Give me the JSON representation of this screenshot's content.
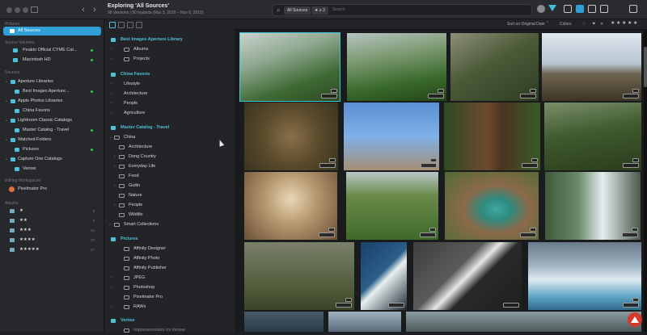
{
  "window": {
    "title": "Exploring 'All Sources'",
    "subtitle": "98 Versions | 90 Instants (Mar 3, 2010 – Nov 6, 2015)"
  },
  "search": {
    "chip_sources": "All Sources",
    "chip_rating": "★ ≥ 3",
    "placeholder": "Search"
  },
  "sidebar": {
    "sec_pictures": "Pictures",
    "all_sources": "All Sources",
    "sec_volumes": "Source Volumes",
    "vol1": "Peakto Official CYME Cat...",
    "vol2": "Macintosh HD",
    "sec_sources": "Sources",
    "aperture": "Aperture Libraries",
    "aperture_child": "Best Images Aperture...",
    "photos": "Apple Photos Libraries",
    "photos_child": "China Favoris",
    "lightroom": "Lightroom Classic Catalogs",
    "lightroom_child": "Master Catalog - Travel",
    "watched": "Watched Folders",
    "watched_child": "Pictures",
    "captureone": "Capture One Catalogs",
    "captureone_child": "Venise",
    "sec_editing": "Editing Workspaces",
    "pixelmator": "Pixelmator Pro",
    "sec_albums": "Albums",
    "ratings": [
      {
        "label": "★",
        "count": "5"
      },
      {
        "label": "★★",
        "count": "8"
      },
      {
        "label": "★★★",
        "count": "24"
      },
      {
        "label": "★★★★",
        "count": "37"
      },
      {
        "label": "★★★★★",
        "count": "27"
      }
    ]
  },
  "browser": {
    "head1": "Best Images Aperture Library",
    "albums": "Albums",
    "projects": "Projects",
    "head2": "China Favoris",
    "lifestyle": "Lifestyle",
    "architecture": "Architecture",
    "people": "People",
    "agriculture": "Agriculture",
    "head3": "Master Catalog - Travel",
    "china": "China",
    "c_architecture": "Architecture",
    "c_dong": "Dong Country",
    "c_everyday": "Everyday Life",
    "c_food": "Food",
    "c_guilin": "Guilin",
    "c_nature": "Nature",
    "c_people": "People",
    "c_wildlife": "Wildlife",
    "smart": "Smart Collections",
    "head4": "Pictures",
    "p_affinity_designer": "Affinity Designer",
    "p_affinity_photo": "Affinity Photo",
    "p_affinity_publisher": "Affinity Publisher",
    "p_jpeg": "JPEG",
    "p_photoshop": "Photoshop",
    "p_pixelmator": "Pixelmator Pro",
    "p_raws": "RAWs",
    "head5": "Venise",
    "p_venise_sub": "Impressionnism Ini Venise"
  },
  "grid": {
    "sort": "Sort on Original Date",
    "colors": "Colors"
  },
  "colors": {
    "accent": "#2f9fd6",
    "cyan": "#4ec0d8",
    "green": "#31c748"
  }
}
